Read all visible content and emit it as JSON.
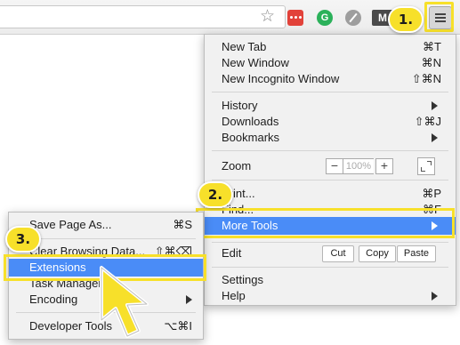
{
  "toolbar": {
    "ext_green_letter": "G",
    "ext_m_letter": "M"
  },
  "steps": {
    "one": "1.",
    "two": "2.",
    "three": "3."
  },
  "main_menu": {
    "new_tab": {
      "label": "New Tab",
      "shortcut": "⌘T"
    },
    "new_window": {
      "label": "New Window",
      "shortcut": "⌘N"
    },
    "new_incognito": {
      "label": "New Incognito Window",
      "shortcut": "⇧⌘N"
    },
    "history": {
      "label": "History"
    },
    "downloads": {
      "label": "Downloads",
      "shortcut": "⇧⌘J"
    },
    "bookmarks": {
      "label": "Bookmarks"
    },
    "zoom": {
      "label": "Zoom",
      "minus": "−",
      "value": "100%",
      "plus": "+"
    },
    "print": {
      "label": "Print...",
      "shortcut": "⌘P"
    },
    "find": {
      "label": "Find...",
      "shortcut": "⌘F"
    },
    "more_tools": {
      "label": "More Tools"
    },
    "edit": {
      "label": "Edit",
      "cut": "Cut",
      "copy": "Copy",
      "paste": "Paste"
    },
    "settings": {
      "label": "Settings"
    },
    "help": {
      "label": "Help"
    }
  },
  "sub_menu": {
    "save_page": {
      "label": "Save Page As...",
      "shortcut": "⌘S"
    },
    "clear_data": {
      "label": "Clear Browsing Data...",
      "shortcut": "⇧⌘⌫"
    },
    "extensions": {
      "label": "Extensions"
    },
    "task_manager": {
      "label": "Task Manager"
    },
    "encoding": {
      "label": "Encoding"
    },
    "developer_tools": {
      "label": "Developer Tools",
      "shortcut": "⌥⌘I"
    }
  },
  "colors": {
    "highlight_yellow": "#f7e02a",
    "menu_selection_blue": "#4a8cf7",
    "menu_background": "#f1f1f1"
  },
  "icons": [
    "star-icon",
    "hamburger-menu-icon",
    "chevron-right-icon",
    "fullscreen-icon",
    "mouse-pointer-icon"
  ]
}
